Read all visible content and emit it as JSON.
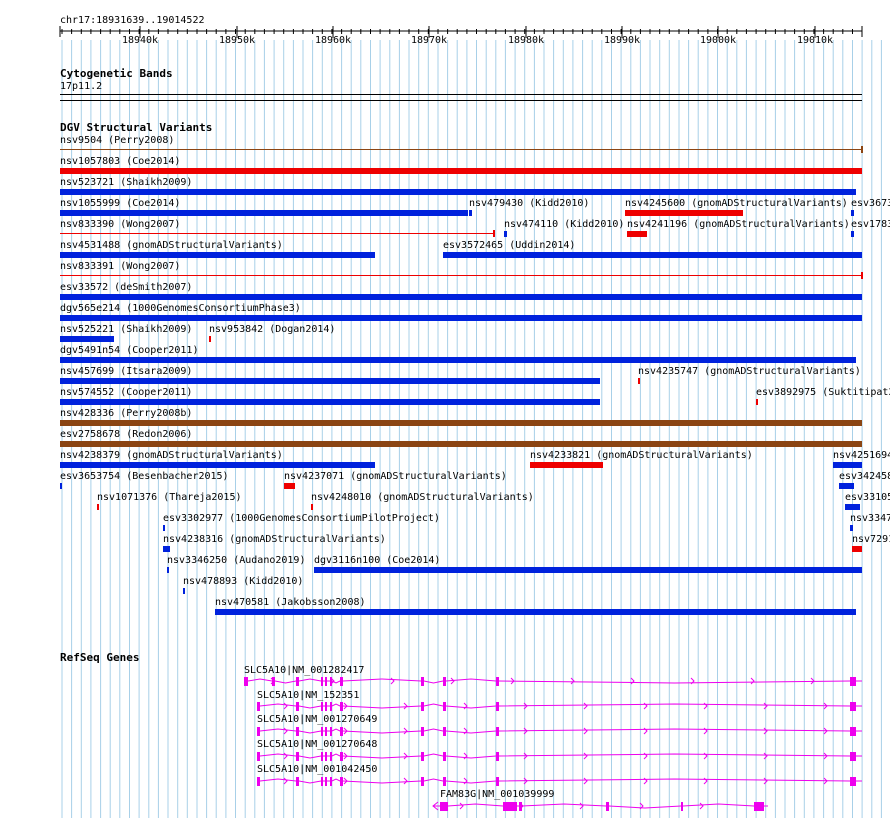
{
  "locus": "chr17:18931639..19014522",
  "ruler": {
    "ticks": [
      "18940k",
      "18950k",
      "18960k",
      "18970k",
      "18980k",
      "18990k",
      "19000k",
      "19010k"
    ]
  },
  "cytoband": {
    "title": "Cytogenetic Bands",
    "band": "17p11.2"
  },
  "dgv": {
    "title": "DGV Structural Variants",
    "features": [
      {
        "label": "nsv9504 (Perry2008)"
      },
      {
        "label": "nsv1057803 (Coe2014)"
      },
      {
        "label": "nsv523721 (Shaikh2009)"
      },
      {
        "label": "nsv1055999 (Coe2014)"
      },
      {
        "label": "nsv479430 (Kidd2010)"
      },
      {
        "label": "nsv4245600 (gnomADStructuralVariants)"
      },
      {
        "label": "esv3673"
      },
      {
        "label": "nsv833390 (Wong2007)"
      },
      {
        "label": "nsv474110 (Kidd2010)"
      },
      {
        "label": "nsv4241196 (gnomADStructuralVariants)"
      },
      {
        "label": "esv1783"
      },
      {
        "label": "nsv4531488 (gnomADStructuralVariants)"
      },
      {
        "label": "esv3572465 (Uddin2014)"
      },
      {
        "label": "nsv833391 (Wong2007)"
      },
      {
        "label": "esv33572 (deSmith2007)"
      },
      {
        "label": "dgv565e214 (1000GenomesConsortiumPhase3)"
      },
      {
        "label": "nsv525221 (Shaikh2009)"
      },
      {
        "label": "nsv953842 (Dogan2014)"
      },
      {
        "label": "dgv5491n54 (Cooper2011)"
      },
      {
        "label": "nsv457699 (Itsara2009)"
      },
      {
        "label": "nsv4235747 (gnomADStructuralVariants)"
      },
      {
        "label": "nsv574552 (Cooper2011)"
      },
      {
        "label": "esv3892975 (Suktitipat2"
      },
      {
        "label": "nsv428336 (Perry2008b)"
      },
      {
        "label": "esv2758678 (Redon2006)"
      },
      {
        "label": "nsv4238379 (gnomADStructuralVariants)"
      },
      {
        "label": "nsv4233821 (gnomADStructuralVariants)"
      },
      {
        "label": "nsv4251694"
      },
      {
        "label": "esv3653754 (Besenbacher2015)"
      },
      {
        "label": "nsv4237071 (gnomADStructuralVariants)"
      },
      {
        "label": "esv342458"
      },
      {
        "label": "nsv1071376 (Thareja2015)"
      },
      {
        "label": "nsv4248010 (gnomADStructuralVariants)"
      },
      {
        "label": "esv33105"
      },
      {
        "label": "esv3302977 (1000GenomesConsortiumPilotProject)"
      },
      {
        "label": "nsv3347"
      },
      {
        "label": "nsv4238316 (gnomADStructuralVariants)"
      },
      {
        "label": "nsv7291"
      },
      {
        "label": "nsv3346250 (Audano2019)"
      },
      {
        "label": "dgv3116n100 (Coe2014)"
      },
      {
        "label": "nsv478893 (Kidd2010)"
      },
      {
        "label": "nsv470581 (Jakobsson2008)"
      }
    ]
  },
  "refseq": {
    "title": "RefSeq Genes",
    "genes": [
      {
        "label": "SLC5A10|NM_001282417"
      },
      {
        "label": "SLC5A10|NM_152351"
      },
      {
        "label": "SLC5A10|NM_001270649"
      },
      {
        "label": "SLC5A10|NM_001270648"
      },
      {
        "label": "SLC5A10|NM_001042450"
      },
      {
        "label": "FAM83G|NM_001039999"
      }
    ]
  },
  "colors": {
    "gridline": "#a8d0e8",
    "loss": "#0022dd",
    "gain": "#ee0000",
    "complex": "#8b4513",
    "gene": "#ee00ee"
  }
}
